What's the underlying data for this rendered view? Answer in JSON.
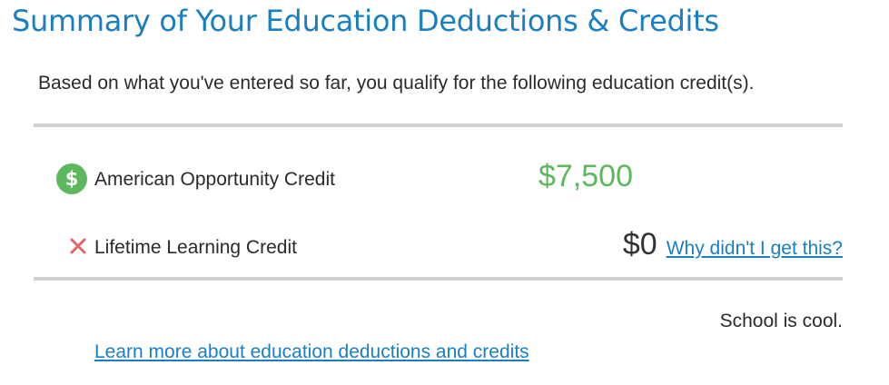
{
  "header": {
    "title": "Summary of Your Education Deductions & Credits"
  },
  "intro_text": "Based on what you've entered so far, you qualify for the following education credit(s).",
  "credits": [
    {
      "name": "American Opportunity Credit",
      "amount": "$7,500",
      "status": "qualified",
      "icon": "dollar-circle-icon",
      "icon_glyph": "$",
      "amount_color": "#5cb85c"
    },
    {
      "name": "Lifetime Learning Credit",
      "amount": "$0",
      "status": "not-qualified",
      "icon": "x-icon",
      "link_label": "Why didn't I get this?"
    }
  ],
  "footer_note": "School is cool.",
  "learn_more_link": "Learn more about education deductions and credits",
  "colors": {
    "title": "#1a7fc1",
    "link": "#1a7fc1",
    "qualified": "#5cb85c",
    "not_qualified": "#e06565",
    "rule": "#cfcfcf"
  }
}
